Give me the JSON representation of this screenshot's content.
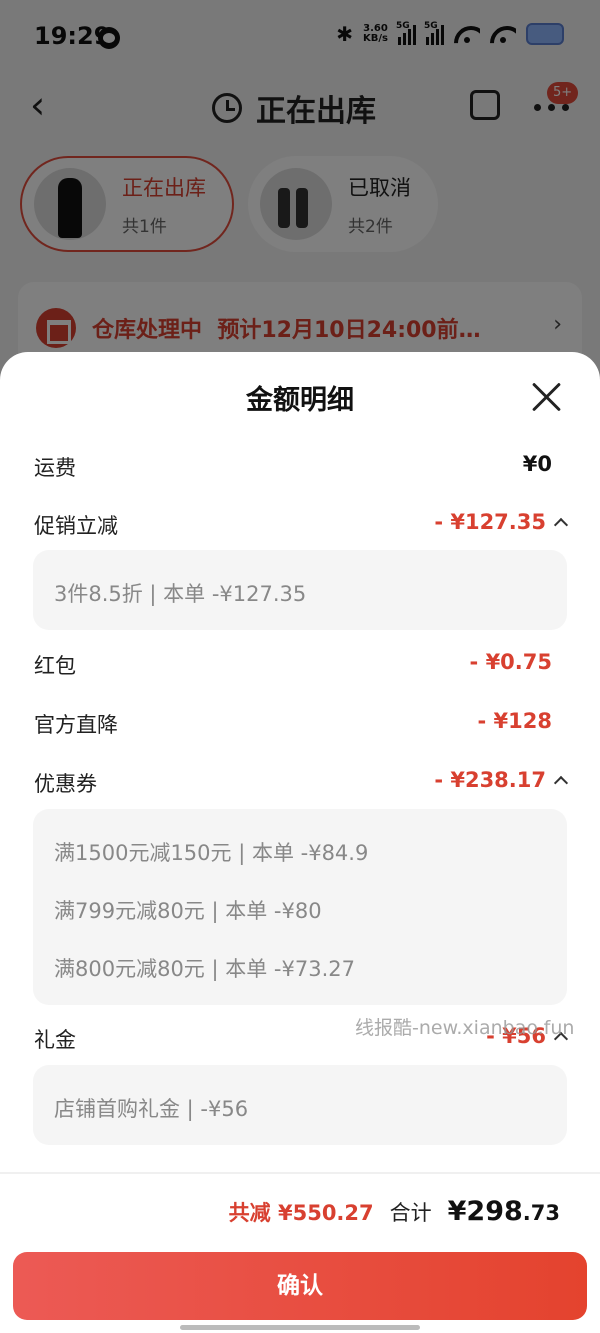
{
  "status_bar": {
    "time": "19:29",
    "net_speed": "3.60",
    "net_unit": "KB/s",
    "sig1": "5G",
    "sig2": "5G"
  },
  "nav": {
    "title": "正在出库",
    "badge": "5+"
  },
  "tabs": [
    {
      "title": "正在出库",
      "count": "共1件",
      "active": true
    },
    {
      "title": "已取消",
      "count": "共2件",
      "active": false
    }
  ],
  "warehouse": {
    "status": "仓库处理中",
    "eta": "预计12月10日24:00前…"
  },
  "sheet": {
    "title": "金额明细",
    "rows": {
      "shipping": {
        "label": "运费",
        "amount": "¥0"
      },
      "promo": {
        "label": "促销立减",
        "amount": "- ¥127.35",
        "details": [
          "3件8.5折 | 本单 -¥127.35"
        ]
      },
      "redpacket": {
        "label": "红包",
        "amount": "- ¥0.75"
      },
      "official": {
        "label": "官方直降",
        "amount": "- ¥128"
      },
      "coupon": {
        "label": "优惠券",
        "amount": "- ¥238.17",
        "details": [
          "满1500元减150元 | 本单 -¥84.9",
          "满799元减80元 | 本单 -¥80",
          "满800元减80元 | 本单 -¥73.27"
        ]
      },
      "gift": {
        "label": "礼金",
        "amount": "- ¥56",
        "details": [
          "店铺首购礼金 | -¥56"
        ]
      }
    },
    "watermark": "线报酷-new.xianbao.fun"
  },
  "footer": {
    "saved": "共减 ¥550.27",
    "total_label": "合计",
    "total_main": "¥298",
    "total_decimal": ".73",
    "confirm": "确认"
  },
  "colors": {
    "accent": "#d84030",
    "button": "#e4432e"
  }
}
